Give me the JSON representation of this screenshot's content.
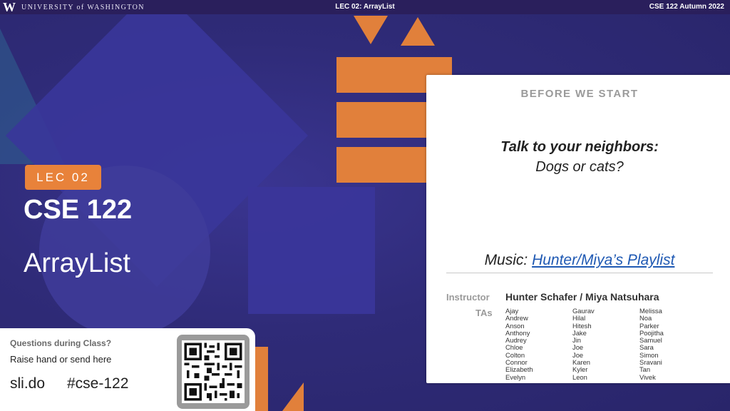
{
  "header": {
    "logo_text": "UNIVERSITY of WASHINGTON",
    "lecture": "LEC 02: ArrayList",
    "term": "CSE 122 Autumn 2022"
  },
  "title_block": {
    "lec_badge": "LEC 02",
    "course": "CSE 122",
    "topic": "ArrayList"
  },
  "slido": {
    "question": "Questions during Class?",
    "instruction": "Raise hand or send here",
    "site": "sli.do",
    "code": "#cse-122"
  },
  "panel": {
    "heading": "BEFORE WE START",
    "prompt": "Talk to your neighbors:",
    "prompt_sub": "Dogs or cats?",
    "music_label": "Music: ",
    "music_link": "Hunter/Miya’s Playlist",
    "instructor_label": "Instructor",
    "instructors": "Hunter Schafer / Miya Natsuhara",
    "tas_label": "TAs",
    "tas_col1": [
      "Ajay",
      "Andrew",
      "Anson",
      "Anthony",
      "Audrey",
      "Chloe",
      "Colton",
      "Connor",
      "Elizabeth",
      "Evelyn"
    ],
    "tas_col2": [
      "Gaurav",
      "Hilal",
      "Hitesh",
      "Jake",
      "Jin",
      "Joe",
      "Joe",
      "Karen",
      "Kyler",
      "Leon"
    ],
    "tas_col3": [
      "Melissa",
      "Noa",
      "Parker",
      "Poojitha",
      "Samuel",
      "Sara",
      "Simon",
      "Sravani",
      "Tan",
      "Vivek"
    ]
  },
  "colors": {
    "background": "#2e2a6b",
    "accent_orange": "#e1803b",
    "link_blue": "#1f59b3"
  }
}
